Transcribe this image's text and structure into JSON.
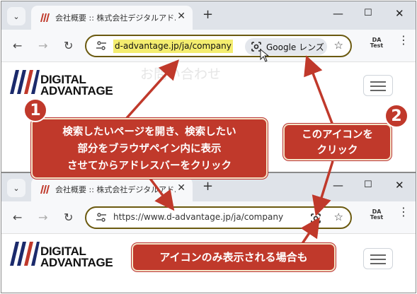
{
  "top": {
    "tab_title": "会社概要 :: 株式会社デジタルアドバンテージ",
    "url": "d-advantage.jp/ja/company",
    "lens_label": "Google レンズ",
    "profile": "DA\nTest",
    "ghost_text": "お問い合わせ"
  },
  "bottom": {
    "tab_title": "会社概要 :: 株式会社デジタルアドバンテージ",
    "url": "https://www.d-advantage.jp/ja/company",
    "profile": "DA\nTest"
  },
  "logo": {
    "line1": "DIGITAL",
    "line2": "ADVANTAGE"
  },
  "callouts": {
    "c1": "検索したいページを開き、検索したい\n部分をブラウザペイン内に表示\nさせてからアドレスバーをクリック",
    "c2": "このアイコンを\nクリック",
    "c3": "アイコンのみ表示される場合も",
    "badge1": "1",
    "badge2": "2"
  },
  "colors": {
    "accent": "#c0392b",
    "highlight": "#f4ed6f",
    "outline": "#6b5a10"
  }
}
